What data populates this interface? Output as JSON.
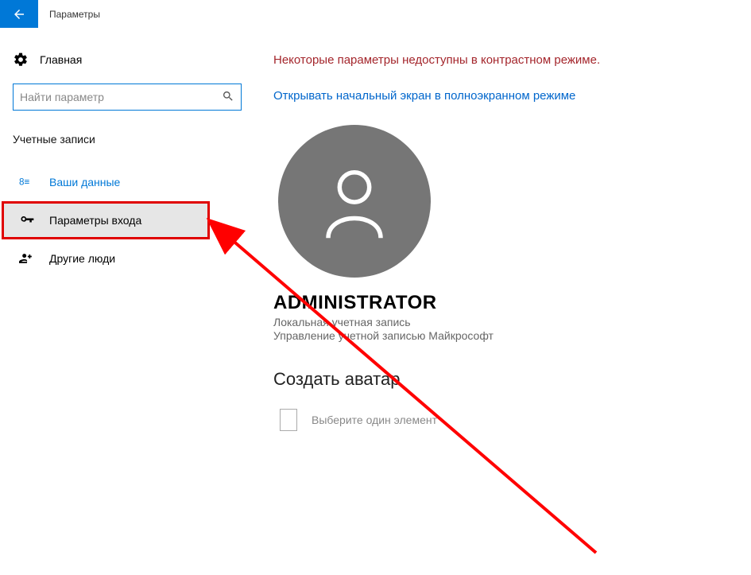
{
  "titlebar": {
    "title": "Параметры"
  },
  "sidebar": {
    "home": "Главная",
    "search_placeholder": "Найти параметр",
    "category": "Учетные записи",
    "items": [
      {
        "label": "Ваши данные"
      },
      {
        "label": "Параметры входа"
      },
      {
        "label": "Другие люди"
      }
    ]
  },
  "main": {
    "warning": "Некоторые параметры недоступны в контрастном режиме.",
    "link": "Открывать начальный экран в полноэкранном режиме",
    "username": "ADMINISTRATOR",
    "account_type": "Локальная учетная запись",
    "ms_manage": "Управление учетной записью Майкрософт",
    "create_avatar": "Создать аватар",
    "pick_one": "Выберите один элемент"
  }
}
